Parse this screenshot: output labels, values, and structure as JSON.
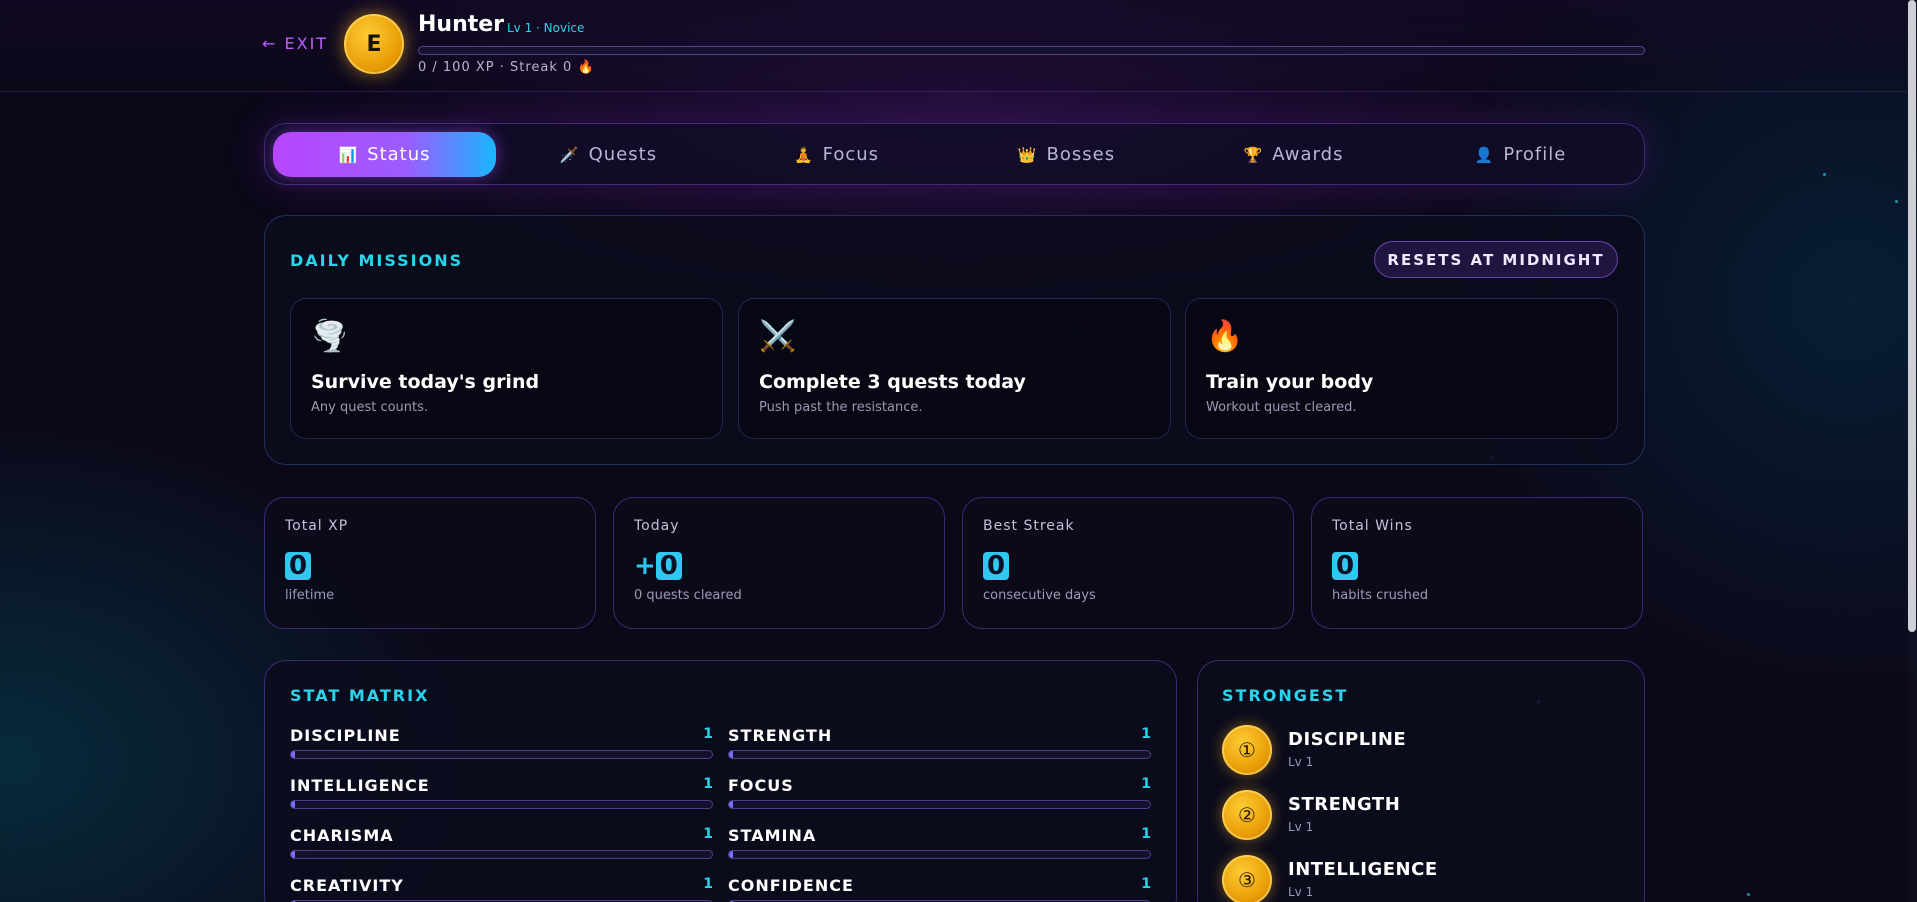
{
  "header": {
    "exit_label": "← EXIT",
    "avatar_letter": "E",
    "name": "Hunter",
    "level_text": "Lv 1 · Novice",
    "xp_progress": 0,
    "xp_text": "0 / 100 XP · Streak 0 🔥"
  },
  "tabs": [
    {
      "icon": "📊",
      "label": "Status",
      "active": true
    },
    {
      "icon": "🗡️",
      "label": "Quests"
    },
    {
      "icon": "🧘",
      "label": "Focus"
    },
    {
      "icon": "👑",
      "label": "Bosses"
    },
    {
      "icon": "🏆",
      "label": "Awards"
    },
    {
      "icon": "👤",
      "label": "Profile"
    }
  ],
  "daily": {
    "title": "DAILY MISSIONS",
    "resets_label": "RESETS AT MIDNIGHT",
    "missions": [
      {
        "icon": "🌪️",
        "title": "Survive today's grind",
        "desc": "Any quest counts."
      },
      {
        "icon": "⚔️",
        "title": "Complete 3 quests today",
        "desc": "Push past the resistance."
      },
      {
        "icon": "🔥",
        "title": "Train your body",
        "desc": "Workout quest cleared."
      }
    ]
  },
  "stats": [
    {
      "label": "Total XP",
      "value": "0",
      "prefix": "",
      "sub": "lifetime"
    },
    {
      "label": "Today",
      "value": "0",
      "prefix": "+",
      "sub": "0 quests cleared"
    },
    {
      "label": "Best Streak",
      "value": "0",
      "prefix": "",
      "sub": "consecutive days"
    },
    {
      "label": "Total Wins",
      "value": "0",
      "prefix": "",
      "sub": "habits crushed"
    }
  ],
  "matrix": {
    "title": "STAT MATRIX",
    "attributes": [
      {
        "name": "DISCIPLINE",
        "value": "1",
        "fill": 0.01
      },
      {
        "name": "STRENGTH",
        "value": "1",
        "fill": 0.01
      },
      {
        "name": "INTELLIGENCE",
        "value": "1",
        "fill": 0.01
      },
      {
        "name": "FOCUS",
        "value": "1",
        "fill": 0.01
      },
      {
        "name": "CHARISMA",
        "value": "1",
        "fill": 0.01
      },
      {
        "name": "STAMINA",
        "value": "1",
        "fill": 0.01
      },
      {
        "name": "CREATIVITY",
        "value": "1",
        "fill": 0.01
      },
      {
        "name": "CONFIDENCE",
        "value": "1",
        "fill": 0.01
      }
    ]
  },
  "strongest": {
    "title": "STRONGEST",
    "items": [
      {
        "medal": "①",
        "name": "DISCIPLINE",
        "level": "Lv 1"
      },
      {
        "medal": "②",
        "name": "STRENGTH",
        "level": "Lv 1"
      },
      {
        "medal": "③",
        "name": "INTELLIGENCE",
        "level": "Lv 1"
      }
    ]
  },
  "colors": {
    "accent_cyan": "#2ad4ea",
    "accent_purple": "#b846ff",
    "gold": "#e79a05",
    "background": "#0b0818"
  }
}
